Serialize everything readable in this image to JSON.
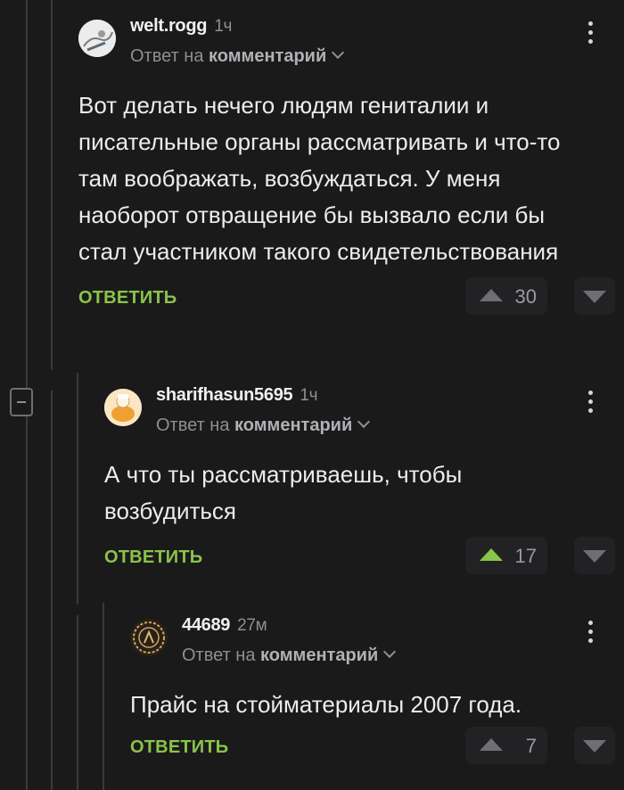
{
  "comments": [
    {
      "username": "welt.rogg",
      "time": "1ч",
      "reply_prefix": "Ответ на",
      "reply_target": "комментарий",
      "text": "Вот делать нечего людям гениталии и писательные органы рассматривать и что-то там воображать, возбуждаться. У меня наоборот отвращение бы вызвало если бы стал участником такого свидетельствования",
      "reply_label": "ОТВЕТИТЬ",
      "rating": "30",
      "upvoted": false,
      "avatar_icon": "user-avatar-photo"
    },
    {
      "username": "sharifhasun5695",
      "time": "1ч",
      "reply_prefix": "Ответ на",
      "reply_target": "комментарий",
      "text": "А что ты рассматриваешь, чтобы возбудиться",
      "reply_label": "ОТВЕТИТЬ",
      "rating": "17",
      "upvoted": true,
      "avatar_icon": "user-avatar-cartoon"
    },
    {
      "username": "44689",
      "time": "27м",
      "reply_prefix": "Ответ на",
      "reply_target": "комментарий",
      "text": "Прайс на стойматериалы 2007 года.",
      "reply_label": "ОТВЕТИТЬ",
      "rating": "7",
      "upvoted": false,
      "avatar_icon": "user-avatar-emblem"
    }
  ],
  "colors": {
    "background": "#1a1a1b",
    "accent_green": "#8bc34a",
    "muted": "#8e8e93"
  }
}
